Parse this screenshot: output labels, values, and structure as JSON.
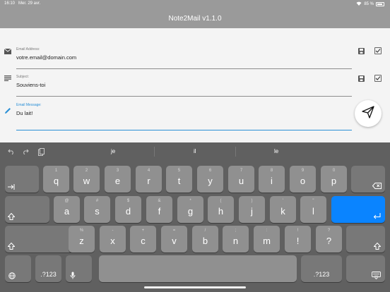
{
  "status": {
    "time": "16:10",
    "date": "Mer. 29 avr.",
    "battery": "85 %"
  },
  "app": {
    "title": "Note2Mail   v1.1.0"
  },
  "fields": {
    "email": {
      "label": "Email Address:",
      "value": "votre.email@domain.com"
    },
    "subject": {
      "label": "Subject:",
      "value": "Souviens-toi"
    },
    "message": {
      "label": "Email Message:",
      "value": "Du lait!"
    }
  },
  "predictions": [
    "je",
    "il",
    "le"
  ],
  "keyboard": {
    "row1": [
      {
        "main": "q",
        "alt": "1"
      },
      {
        "main": "w",
        "alt": "2"
      },
      {
        "main": "e",
        "alt": "3"
      },
      {
        "main": "r",
        "alt": "4"
      },
      {
        "main": "t",
        "alt": "5"
      },
      {
        "main": "y",
        "alt": "6"
      },
      {
        "main": "u",
        "alt": "7"
      },
      {
        "main": "i",
        "alt": "8"
      },
      {
        "main": "o",
        "alt": "9"
      },
      {
        "main": "p",
        "alt": "0"
      }
    ],
    "row2": [
      {
        "main": "a",
        "alt": "@"
      },
      {
        "main": "s",
        "alt": "#"
      },
      {
        "main": "d",
        "alt": "$"
      },
      {
        "main": "f",
        "alt": "&"
      },
      {
        "main": "g",
        "alt": "*"
      },
      {
        "main": "h",
        "alt": "("
      },
      {
        "main": "j",
        "alt": ")"
      },
      {
        "main": "k",
        "alt": "'"
      },
      {
        "main": "l",
        "alt": "\""
      }
    ],
    "row3": [
      {
        "main": "z",
        "alt": "%"
      },
      {
        "main": "x",
        "alt": "-"
      },
      {
        "main": "c",
        "alt": "+"
      },
      {
        "main": "v",
        "alt": "="
      },
      {
        "main": "b",
        "alt": "/"
      },
      {
        "main": "n",
        "alt": ";"
      },
      {
        "main": "m",
        "alt": ":"
      },
      {
        "main": "!",
        "alt": "!"
      },
      {
        "main": "?",
        "alt": "?"
      }
    ],
    "num_label": ".?123"
  },
  "colors": {
    "accent": "#2a8fd6",
    "return_key": "#0a84ff"
  }
}
